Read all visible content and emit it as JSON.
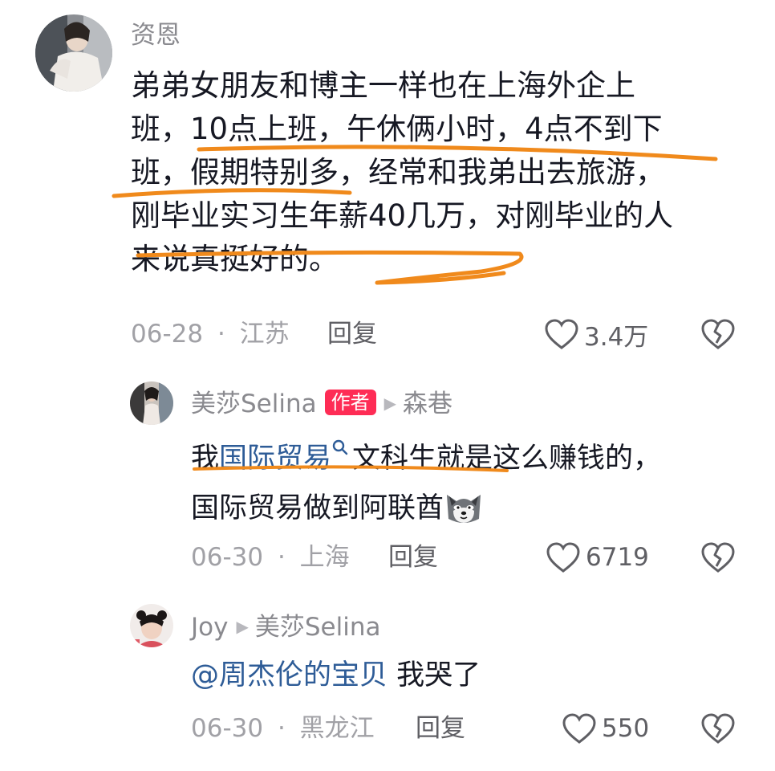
{
  "comments": [
    {
      "username": "资恩",
      "text_lines": [
        "弟弟女朋友和博主一样也在上海外企上",
        "班，10点上班，午休俩小时，4点不到下",
        "班，假期特别多，经常和我弟出去旅游，",
        "刚毕业实习生年薪40几万，对刚毕业的人",
        "来说真挺好的。"
      ],
      "date": "06-28",
      "location": "江苏",
      "reply_label": "回复",
      "likes": "3.4万"
    },
    {
      "username": "美莎Selina",
      "badge": "作者",
      "reply_to": "森巷",
      "text_pre": "我",
      "text_link": "国际贸易",
      "text_post": "文科生就是这么赚钱的，",
      "text_line2": "国际贸易做到阿联酋",
      "date": "06-30",
      "location": "上海",
      "reply_label": "回复",
      "likes": "6719"
    },
    {
      "username": "Joy",
      "reply_to": "美莎Selina",
      "mention": "@周杰伦的宝贝",
      "text": " 我哭了",
      "date": "06-30",
      "location": "黑龙江",
      "reply_label": "回复",
      "likes": "550"
    }
  ],
  "separator": "·",
  "watermark": "",
  "colors": {
    "annotation": "#f08a1c",
    "badge": "#fe2c55",
    "link": "#2e5c97",
    "meta": "#a1a1a6"
  },
  "icons": {
    "like": "heart-outline-icon",
    "dislike": "broken-heart-icon",
    "search": "search-icon",
    "reply_arrow": "play-arrow-icon",
    "emoji": "wolf-dog-emoji"
  }
}
